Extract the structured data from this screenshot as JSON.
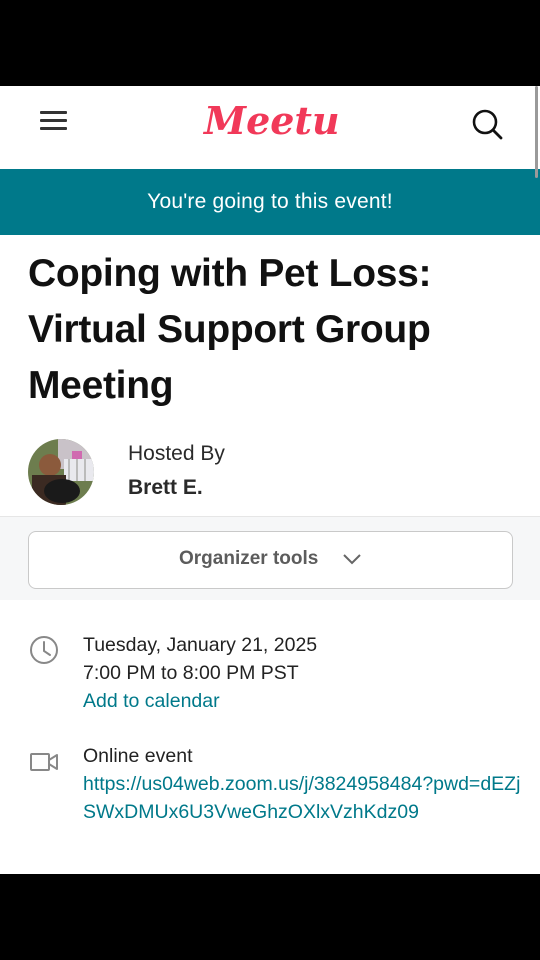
{
  "header": {
    "logo_text": "Meetup",
    "menu_icon": "hamburger-menu-icon",
    "search_icon": "search-icon"
  },
  "banner": {
    "text": "You're going to this event!"
  },
  "event": {
    "title": "Coping with Pet Loss: Virtual Support Group Meeting",
    "hosted_by_label": "Hosted By",
    "host_name": "Brett E."
  },
  "organizer_tools": {
    "label": "Organizer tools"
  },
  "datetime": {
    "date": "Tuesday, January 21, 2025",
    "time": "7:00 PM to 8:00 PM PST",
    "add_to_calendar": "Add to calendar"
  },
  "location": {
    "type": "Online event",
    "url": "https://us04web.zoom.us/j/3824958484?pwd=dEZjSWxDMUx6U3VweGhzOXlxVzhKdz09"
  },
  "colors": {
    "brand_red": "#f13959",
    "teal": "#00798a"
  }
}
